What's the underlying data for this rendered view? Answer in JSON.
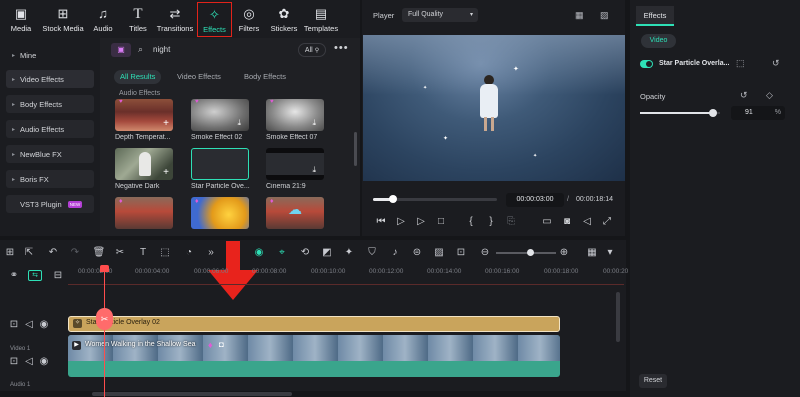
{
  "toolbar": {
    "items": [
      {
        "label": "Media",
        "icon": "media-icon",
        "glyph": "▣"
      },
      {
        "label": "Stock Media",
        "icon": "stock-media-icon",
        "glyph": "⊞"
      },
      {
        "label": "Audio",
        "icon": "music-note-icon",
        "glyph": "♫"
      },
      {
        "label": "Titles",
        "icon": "titles-icon",
        "glyph": "T"
      },
      {
        "label": "Transitions",
        "icon": "transitions-icon",
        "glyph": "⇄"
      },
      {
        "label": "Effects",
        "icon": "effects-icon",
        "glyph": "✧"
      },
      {
        "label": "Filters",
        "icon": "filters-icon",
        "glyph": "◎"
      },
      {
        "label": "Stickers",
        "icon": "stickers-icon",
        "glyph": "✿"
      },
      {
        "label": "Templates",
        "icon": "templates-icon",
        "glyph": "▤"
      }
    ],
    "active": "Effects"
  },
  "sidebar": {
    "items": [
      {
        "label": "Mine"
      },
      {
        "label": "Video Effects"
      },
      {
        "label": "Body Effects"
      },
      {
        "label": "Audio Effects"
      },
      {
        "label": "NewBlue FX"
      },
      {
        "label": "Boris FX"
      },
      {
        "label": "VST3 Plugin",
        "badge": "NEW"
      }
    ]
  },
  "library": {
    "search_value": "night",
    "all_filter": "All",
    "tabs": [
      "All Results",
      "Video Effects",
      "Body Effects"
    ],
    "section_title": "Audio Effects",
    "items": [
      {
        "label": "Depth Temperat..."
      },
      {
        "label": "Smoke Effect 02"
      },
      {
        "label": "Smoke Effect 07"
      },
      {
        "label": "Negative Dark"
      },
      {
        "label": "Star Particle Ove..."
      },
      {
        "label": "Cinema 21:9"
      },
      {
        "label": ""
      },
      {
        "label": ""
      },
      {
        "label": ""
      }
    ]
  },
  "player": {
    "label": "Player",
    "quality": "Full Quality",
    "current_time": "00:00:03:00",
    "separator": "/",
    "total_time": "00:00:18:14",
    "progress": 0.16
  },
  "properties": {
    "tab": "Effects",
    "subtab": "Video",
    "effect_name": "Star Particle Overla...",
    "opacity_label": "Opacity",
    "opacity_value": "91",
    "opacity_unit": "%",
    "opacity_fraction": 0.91,
    "reset_label": "Reset"
  },
  "timeline": {
    "ruler": [
      "00:00:02:00",
      "00:00:04:00",
      "00:00:06:00",
      "00:00:08:00",
      "00:00:10:00",
      "00:00:12:00",
      "00:00:14:00",
      "00:00:16:00",
      "00:00:18:00",
      "00:00:20"
    ],
    "effect_clip": "Star Particle Overlay 02",
    "video_clip": "Women Walking in the Shallow Sea",
    "track_video": "Video 1",
    "track_audio": "Audio 1"
  },
  "colors": {
    "accent": "#2ee0b6",
    "effect_clip": "#c9a45c",
    "video_clip": "#3aa58c",
    "playhead": "#ff4d4d",
    "highlight": "#e2231a"
  }
}
